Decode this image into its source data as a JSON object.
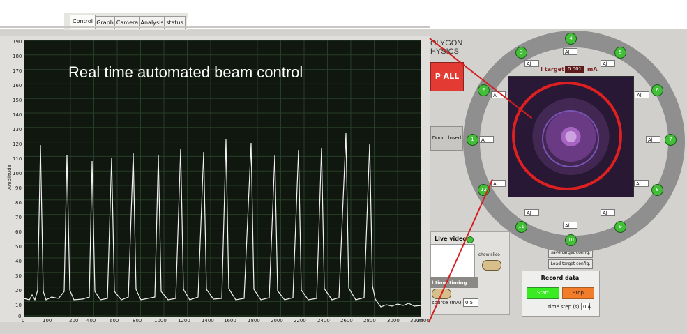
{
  "tabs": [
    "Control",
    "Graph",
    "Camera",
    "Analysis",
    "status"
  ],
  "graph": {
    "title_overlay": "Real time automated beam control",
    "y_label": "Amplitude",
    "y_ticks": [
      "190",
      "180",
      "170",
      "160",
      "150",
      "140",
      "130",
      "120",
      "110",
      "100",
      "90",
      "80",
      "70",
      "60",
      "50",
      "40",
      "30",
      "20",
      "10",
      "0"
    ],
    "x_ticks": [
      "0",
      "100",
      "200",
      "400",
      "600",
      "800",
      "1000",
      "1200",
      "1400",
      "1600",
      "1800",
      "2000",
      "2200",
      "2400",
      "2600",
      "2800",
      "3000",
      "3200",
      "3400"
    ]
  },
  "left_controls": {
    "logo_line1": "OLYGON",
    "logo_line2": "HYSICS",
    "stop_all": "P ALL",
    "door_closed": "Door closed",
    "live_video": "Live video",
    "show_slice": "show slice",
    "time_timing": "l time timing",
    "source_label": "source (mA)",
    "source_value": "0.5",
    "save_target_config": "save target config.",
    "load_target_config": "Load target config."
  },
  "record_data": {
    "title": "Record data",
    "start": "Start",
    "stop": "Stop",
    "time_step_label": "time step (s)",
    "time_step_value": "0.4"
  },
  "target_ring": {
    "title": "I target",
    "value": "0.001",
    "unit": "mA",
    "nodes": [
      "1",
      "2",
      "3",
      "4",
      "5",
      "6",
      "7",
      "8",
      "9",
      "10",
      "11",
      "12"
    ],
    "ai_boxes": [
      "Al",
      "Al",
      "Al",
      "Al",
      "Al",
      "Al",
      "Al",
      "Al",
      "Al",
      "Al",
      "Al",
      "Al"
    ]
  }
}
